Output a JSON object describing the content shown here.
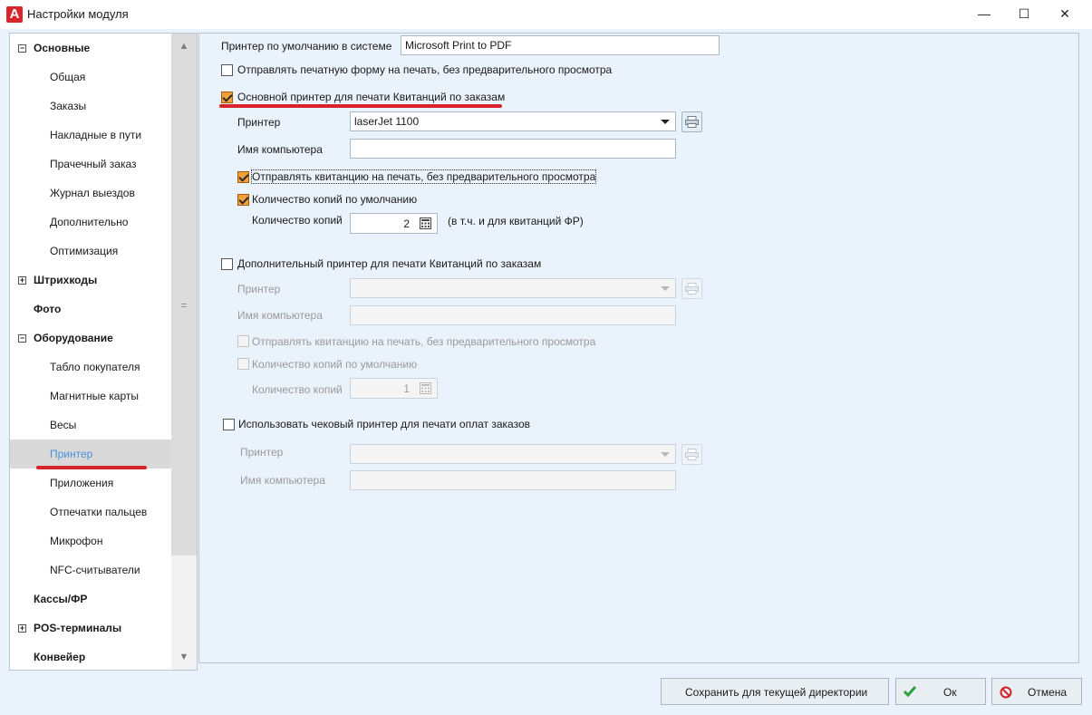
{
  "window": {
    "title": "Настройки модуля",
    "app_icon_letter": "A",
    "minimize_glyph": "—",
    "maximize_glyph": "☐",
    "close_glyph": "✕"
  },
  "tree": {
    "items": [
      {
        "label": "Основные",
        "kind": "group",
        "expander": "−"
      },
      {
        "label": "Общая",
        "kind": "child"
      },
      {
        "label": "Заказы",
        "kind": "child"
      },
      {
        "label": "Накладные в пути",
        "kind": "child"
      },
      {
        "label": "Прачечный заказ",
        "kind": "child"
      },
      {
        "label": "Журнал выездов",
        "kind": "child"
      },
      {
        "label": "Дополнительно",
        "kind": "child"
      },
      {
        "label": "Оптимизация",
        "kind": "child"
      },
      {
        "label": "Штрихкоды",
        "kind": "group",
        "expander": "+"
      },
      {
        "label": "Фото",
        "kind": "group"
      },
      {
        "label": "Оборудование",
        "kind": "group",
        "expander": "−"
      },
      {
        "label": "Табло покупателя",
        "kind": "child"
      },
      {
        "label": "Магнитные карты",
        "kind": "child"
      },
      {
        "label": "Весы",
        "kind": "child"
      },
      {
        "label": "Принтер",
        "kind": "child",
        "selected": true
      },
      {
        "label": "Приложения",
        "kind": "child"
      },
      {
        "label": "Отпечатки пальцев",
        "kind": "child"
      },
      {
        "label": "Микрофон",
        "kind": "child"
      },
      {
        "label": "NFC-считыватели",
        "kind": "child"
      },
      {
        "label": "Кассы/ФР",
        "kind": "group"
      },
      {
        "label": "POS-терминалы",
        "kind": "group",
        "expander": "+"
      },
      {
        "label": "Конвейер",
        "kind": "group"
      }
    ],
    "scroll_grip": "="
  },
  "settings": {
    "default_printer_label": "Принтер по умолчанию в системе",
    "default_printer_value": "Microsoft Print to PDF",
    "send_without_preview_label": "Отправлять печатную форму на печать, без предварительного просмотра",
    "send_without_preview_checked": false,
    "main_printer": {
      "checkbox_label": "Основной принтер для печати Квитанций по заказам",
      "checked": true,
      "printer_label": "Принтер",
      "printer_value": "laserJet 1100",
      "computer_label": "Имя компьютера",
      "computer_value": "",
      "send_receipt_label": "Отправлять квитанцию на печать, без предварительного просмотра",
      "send_receipt_checked": true,
      "default_copies_label": "Количество копий по умолчанию",
      "default_copies_checked": true,
      "copies_label": "Количество копий",
      "copies_value": "2",
      "copies_note": "(в т.ч. и для квитанций ФР)"
    },
    "additional_printer": {
      "checkbox_label": "Дополнительный принтер для печати Квитанций по заказам",
      "checked": false,
      "printer_label": "Принтер",
      "printer_value": "",
      "computer_label": "Имя компьютера",
      "computer_value": "",
      "send_receipt_label": "Отправлять квитанцию на печать, без предварительного просмотра",
      "send_receipt_checked": false,
      "default_copies_label": "Количество копий по умолчанию",
      "default_copies_checked": false,
      "copies_label": "Количество копий",
      "copies_value": "1"
    },
    "receipt_printer": {
      "checkbox_label": "Использовать чековый принтер для печати оплат заказов",
      "checked": false,
      "printer_label": "Принтер",
      "printer_value": "",
      "computer_label": "Имя компьютера",
      "computer_value": ""
    }
  },
  "buttons": {
    "save_dir": "Сохранить для текущей директории",
    "ok": "Ок",
    "cancel": "Отмена"
  },
  "colors": {
    "accent_orange": "#f2a13a",
    "highlight_red": "#d9232a",
    "ok_green": "#2e9e3e",
    "cancel_red": "#d2232a",
    "panel_bg": "#eaf3fb"
  }
}
